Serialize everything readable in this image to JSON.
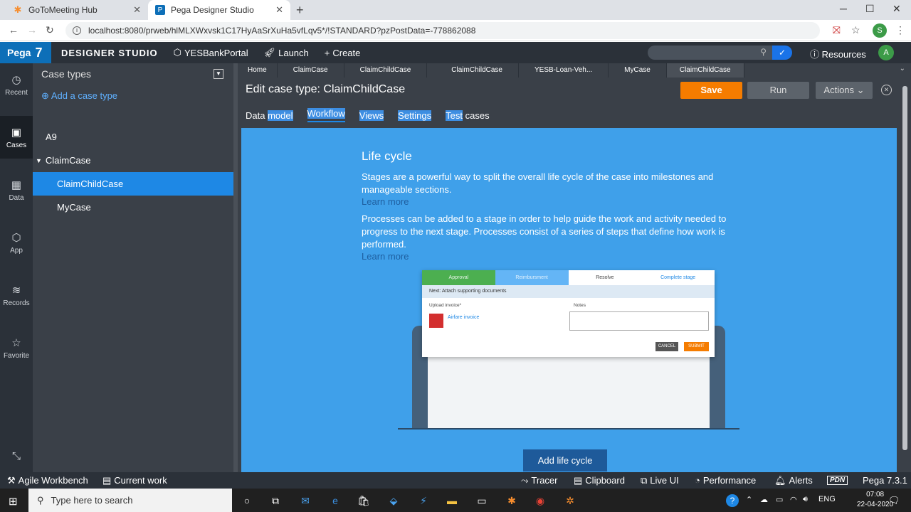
{
  "browser": {
    "tabs": [
      {
        "label": "GoToMeeting Hub",
        "icon": "gotomeeting-icon"
      },
      {
        "label": "Pega Designer Studio",
        "icon": "pega-icon"
      }
    ],
    "url": "localhost:8080/prweb/hlMLXWxvsk1C17HyAaSrXuHa5vfLqv5*/!STANDARD?pzPostData=-778862088",
    "profile_initial": "S"
  },
  "pega_header": {
    "logo": "Pega",
    "version": "7",
    "studio": "DESIGNER STUDIO",
    "app": "YESBankPortal",
    "launch": "Launch",
    "create": "Create",
    "resources": "Resources",
    "avatar": "A"
  },
  "left_nav": [
    {
      "label": "Recent",
      "icon": "clock-icon"
    },
    {
      "label": "Cases",
      "icon": "briefcase-icon"
    },
    {
      "label": "Data",
      "icon": "grid-icon"
    },
    {
      "label": "App",
      "icon": "cube-icon"
    },
    {
      "label": "Records",
      "icon": "layers-icon"
    },
    {
      "label": "Favorite",
      "icon": "star-icon"
    }
  ],
  "explorer": {
    "title": "Case types",
    "add_label": "Add a case type",
    "items": [
      {
        "label": "A9"
      },
      {
        "label": "ClaimCase"
      },
      {
        "label": "ClaimChildCase"
      },
      {
        "label": "MyCase"
      }
    ]
  },
  "work_tabs": [
    "Home",
    "ClaimCase",
    "ClaimChildCase",
    "ClaimChildCase",
    "YESB-Loan-Veh...",
    "MyCase",
    "ClaimChildCase"
  ],
  "editor": {
    "title": "Edit case type:  ClaimChildCase",
    "save": "Save",
    "run": "Run",
    "actions": "Actions",
    "subtabs": [
      {
        "a": "Data ",
        "b": "model"
      },
      {
        "a": "",
        "b": "Workflow"
      },
      {
        "a": "",
        "b": "Views"
      },
      {
        "a": "",
        "b": "Settings"
      },
      {
        "a": "Test",
        "b": " cases"
      }
    ]
  },
  "lifecycle": {
    "title": "Life cycle",
    "p1": "Stages are a powerful way to split the overall life cycle of the case into milestones and manageable sections.",
    "learn1": "Learn more",
    "p2": "Processes can be added to a stage in order to help guide the work and activity needed to progress to the next stage. Processes consist of a series of steps that define how work is performed.",
    "learn2": "Learn more",
    "button": "Add life cycle",
    "illustration": {
      "stages": [
        "Approval",
        "Reimbursment",
        "Resolve",
        "Complete stage"
      ],
      "next": "Next: Attach supporting documents",
      "upload": "Upload invoice*",
      "notes": "Notes",
      "file": "Airfare invoice",
      "cancel": "CANCEL",
      "submit": "SUBMIT"
    }
  },
  "statusbar": {
    "agile": "Agile Workbench",
    "current": "Current work",
    "tracer": "Tracer",
    "clipboard": "Clipboard",
    "liveui": "Live UI",
    "performance": "Performance",
    "alerts": "Alerts",
    "pdn": "PDN",
    "version": "Pega 7.3.1"
  },
  "taskbar": {
    "search": "Type here to search",
    "lang": "ENG",
    "time": "07:08",
    "date": "22-04-2020"
  }
}
